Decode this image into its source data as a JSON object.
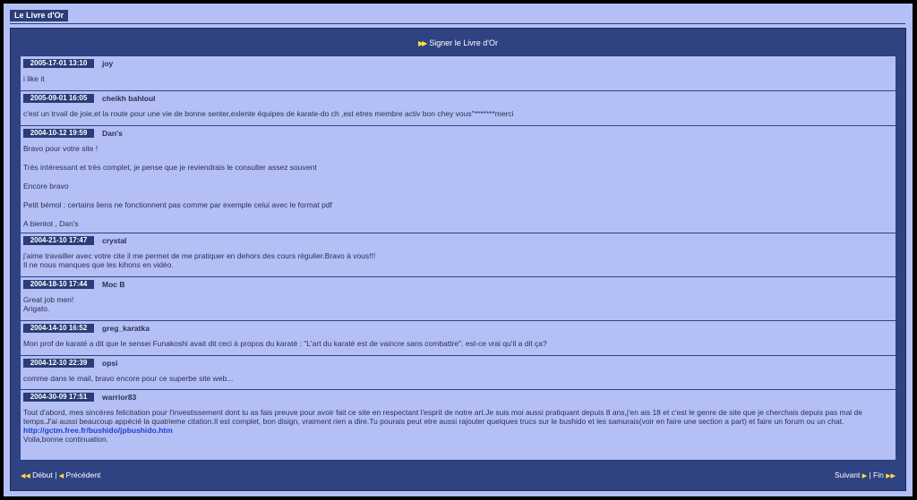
{
  "header": {
    "title": "Le Livre d'Or"
  },
  "sign_link": {
    "label": "Signer le Livre d'Or"
  },
  "entries": [
    {
      "date": "2005-17-01 13:10",
      "author": "joy",
      "lines": [
        "i like it"
      ]
    },
    {
      "date": "2005-09-01 16:05",
      "author": "cheikh bahloul",
      "lines": [
        "c'est un trvail de joie,et la route pour une vie de bonne senter,exlente équipes de karate-do ch ,est etres membre activ bon chey vous\"*******merci"
      ]
    },
    {
      "date": "2004-10-12 19:59",
      "author": "Dan's",
      "lines": [
        "Bravo pour votre site !",
        "Très intéressant et très complet, je pense que je reviendrais le consulter assez souvent",
        "Encore bravo",
        "Petit bémol : certains liens ne fonctionnent pas comme par exemple celui avec le format pdf",
        "A bientot , Dan's"
      ]
    },
    {
      "date": "2004-21-10 17:47",
      "author": "crystal",
      "lines": [
        "j'aime travailler avec votre cite il me permet de me pratiquer en dehors des cours régulier.Bravo à vous!!!",
        "Il ne nous manques que les kihons en vidéo."
      ]
    },
    {
      "date": "2004-18-10 17:44",
      "author": "Moc B",
      "lines": [
        "Great job men!",
        "Arigato."
      ]
    },
    {
      "date": "2004-14-10 16:52",
      "author": "greg_karatka",
      "lines": [
        "Mon prof de karaté a dit que le sensei Funakoshi avait dit ceci à propos du karaté : \"L'art du karaté est de vaincre sans combattre\". est-ce vrai qu'il a dit ça?"
      ]
    },
    {
      "date": "2004-12-10 22:39",
      "author": "opsi",
      "lines": [
        "comme dans le mail, bravo encore pour ce superbe site web..."
      ]
    },
    {
      "date": "2004-30-09 17:51",
      "author": "warrior83",
      "lines": [
        "Tout d'abord, mes sincères felicitation pour l'investissement dont tu as fais preuve pour avoir fait ce site en respectant l'esprit de notre art.Je suis moi aussi pratiquant depuis 8 ans,j'en ais 18 et c'est le genre de site que je cherchais depuis pas mal de temps.J'ai aussi beaucoup appécié la quatrieme citation.Il est complet, bon disign, vraiment rien a dire.Tu pourais peut etre aussi rajouter quelques trucs sur le bushido et les samurais(voir en faire une section a part) et faire un forum ou un chat.",
        "Voila,bonne continuation."
      ],
      "link": "http://gctm.free.fr/bushido/jpbushido.htm"
    }
  ],
  "nav": {
    "first": "Début",
    "sep": " | ",
    "prev": "Précédent",
    "next": "Suivant",
    "last": "Fin"
  },
  "colors": {
    "background": "#b4bff5",
    "panel": "#2f4281",
    "badge": "#2b3c78",
    "arrow": "#ffe046",
    "link": "#1f3fd0"
  },
  "icons": {
    "sign": "double-arrow-right-icon",
    "first": "double-arrow-left-icon",
    "prev": "arrow-left-icon",
    "next": "arrow-right-icon",
    "last": "double-arrow-right-icon"
  }
}
